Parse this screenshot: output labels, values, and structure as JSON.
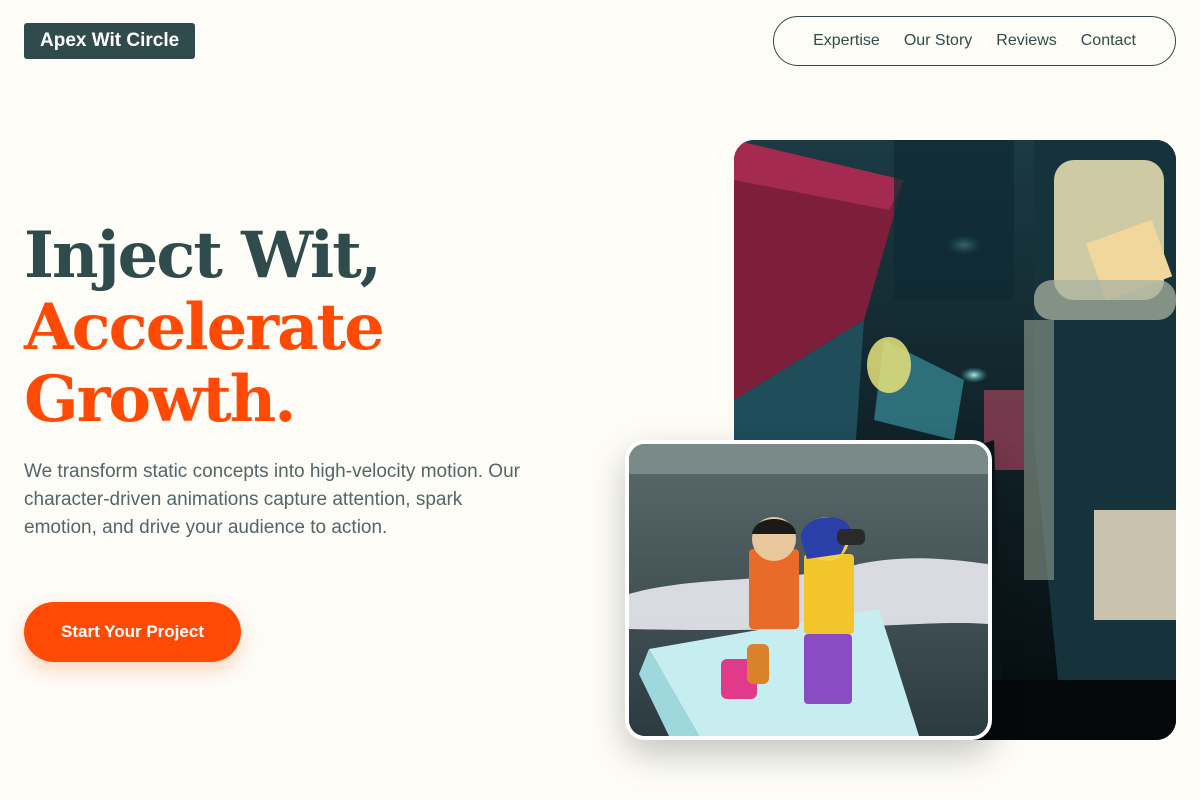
{
  "brand": {
    "name": "Apex Wit Circle"
  },
  "nav": {
    "links": [
      {
        "label": "Expertise"
      },
      {
        "label": "Our Story"
      },
      {
        "label": "Reviews"
      },
      {
        "label": "Contact"
      }
    ]
  },
  "hero": {
    "headline_line1": "Inject Wit,",
    "headline_line2": "Accelerate",
    "headline_line3": "Growth.",
    "description": "We transform static concepts into high-velocity motion. Our character-driven animations capture attention, spark emotion, and drive your audience to action.",
    "cta_label": "Start Your Project"
  },
  "colors": {
    "background": "#fdfcf6",
    "primary": "#2f4b4c",
    "accent": "#ff4a05",
    "body_text": "#52666a"
  },
  "images": {
    "street_photo": "neon-alley-street-photo",
    "lego_photo": "lego-figures-paper-boat-photo"
  }
}
